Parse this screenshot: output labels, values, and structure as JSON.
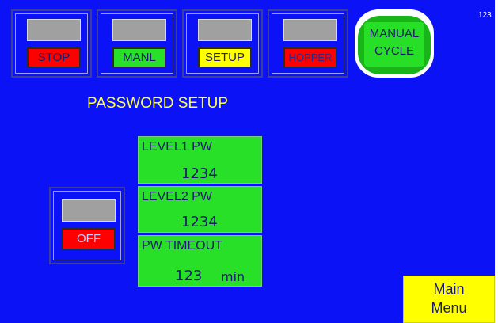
{
  "top_buttons": [
    {
      "label": "STOP"
    },
    {
      "label": "MANL"
    },
    {
      "label": "SETUP"
    },
    {
      "label": "HOPPER"
    }
  ],
  "manual_cycle": {
    "line1": "MANUAL",
    "line2": "CYCLE"
  },
  "screen_code": "123",
  "title": "PASSWORD SETUP",
  "level1": {
    "caption": "LEVEL1 PW",
    "value": "1234"
  },
  "level2": {
    "caption": "LEVEL2 PW",
    "value": "1234"
  },
  "timeout": {
    "caption": "PW TIMEOUT",
    "value": "123",
    "unit": "min"
  },
  "off_toggle": {
    "label": "OFF"
  },
  "main_menu": {
    "line1": "Main",
    "line2": "Menu"
  },
  "colors": {
    "background": "#0b12f5",
    "green": "#28e028",
    "red": "#ff0000",
    "yellow": "#ffff00",
    "indicator": "#a0a0a0"
  }
}
